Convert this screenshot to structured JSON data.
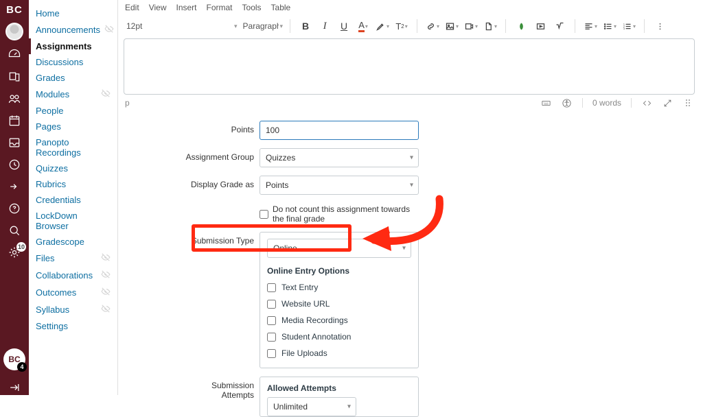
{
  "brand": "BC",
  "rail_badges": {
    "history": "10",
    "bottom_logo": "4"
  },
  "course_nav": [
    {
      "label": "Home",
      "hidden": false
    },
    {
      "label": "Announcements",
      "hidden": true
    },
    {
      "label": "Assignments",
      "hidden": false,
      "active": true
    },
    {
      "label": "Discussions",
      "hidden": false
    },
    {
      "label": "Grades",
      "hidden": false
    },
    {
      "label": "Modules",
      "hidden": true
    },
    {
      "label": "People",
      "hidden": false
    },
    {
      "label": "Pages",
      "hidden": false
    },
    {
      "label": "Panopto Recordings",
      "hidden": false
    },
    {
      "label": "Quizzes",
      "hidden": false
    },
    {
      "label": "Rubrics",
      "hidden": false
    },
    {
      "label": "Credentials",
      "hidden": false
    },
    {
      "label": "LockDown Browser",
      "hidden": false
    },
    {
      "label": "Gradescope",
      "hidden": false
    },
    {
      "label": "Files",
      "hidden": true
    },
    {
      "label": "Collaborations",
      "hidden": true
    },
    {
      "label": "Outcomes",
      "hidden": true
    },
    {
      "label": "Syllabus",
      "hidden": true
    },
    {
      "label": "Settings",
      "hidden": false
    }
  ],
  "rce": {
    "menus": [
      "Edit",
      "View",
      "Insert",
      "Format",
      "Tools",
      "Table"
    ],
    "font_size": "12pt",
    "block_format": "Paragraph",
    "path": "p",
    "word_count": "0 words"
  },
  "labels": {
    "points": "Points",
    "group": "Assignment Group",
    "display": "Display Grade as",
    "exclude": "Do not count this assignment towards the final grade",
    "sub_type": "Submission Type",
    "entry_heading": "Online Entry Options",
    "opt_text": "Text Entry",
    "opt_url": "Website URL",
    "opt_media": "Media Recordings",
    "opt_annot": "Student Annotation",
    "opt_files": "File Uploads",
    "attempts_label": "Submission Attempts",
    "attempts_heading": "Allowed Attempts"
  },
  "values": {
    "points": "100",
    "group": "Quizzes",
    "display": "Points",
    "sub_type": "Online",
    "attempts": "Unlimited"
  }
}
